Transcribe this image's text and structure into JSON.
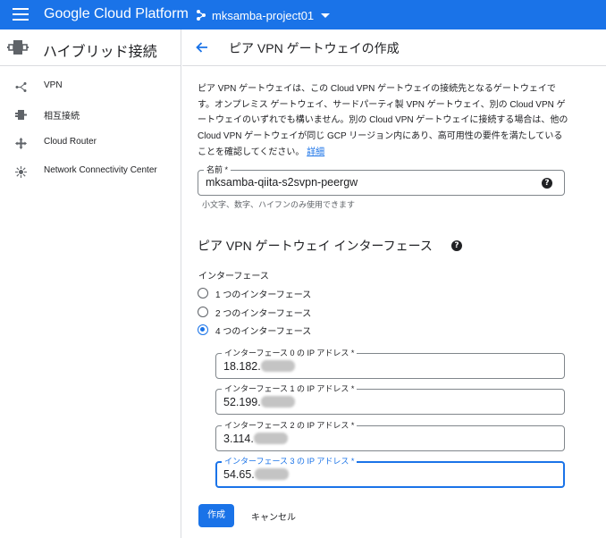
{
  "topbar": {
    "brand": "Google Cloud Platform",
    "project": "mksamba-project01"
  },
  "sidebar": {
    "title": "ハイブリッド接続",
    "items": [
      {
        "label": "VPN",
        "icon": "vpn-icon"
      },
      {
        "label": "相互接続",
        "icon": "interconnect-icon"
      },
      {
        "label": "Cloud Router",
        "icon": "cloud-router-icon"
      },
      {
        "label": "Network Connectivity Center",
        "icon": "network-connectivity-icon"
      }
    ]
  },
  "main": {
    "title": "ピア VPN ゲートウェイの作成",
    "description": "ピア VPN ゲートウェイは、この Cloud VPN ゲートウェイの接続先となるゲートウェイです。オンプレミス ゲートウェイ、サードパーティ製 VPN ゲートウェイ、別の Cloud VPN ゲートウェイのいずれでも構いません。別の Cloud VPN ゲートウェイに接続する場合は、他の Cloud VPN ゲートウェイが同じ GCP リージョン内にあり、高可用性の要件を満たしていることを確認してください。",
    "details_link": "詳細",
    "name_field": {
      "label": "名前 *",
      "value": "mksamba-qiita-s2svpn-peergw",
      "hint": "小文字、数字、ハイフンのみ使用できます"
    },
    "interfaces_section": {
      "title": "ピア VPN ゲートウェイ インターフェース",
      "label": "インターフェース",
      "options": [
        "1 つのインターフェース",
        "2 つのインターフェース",
        "4 つのインターフェース"
      ],
      "selected_index": 2,
      "ip_fields": [
        {
          "label": "インターフェース 0 の IP アドレス *",
          "value": "18.182."
        },
        {
          "label": "インターフェース 1 の IP アドレス *",
          "value": "52.199."
        },
        {
          "label": "インターフェース 2 の IP アドレス *",
          "value": "3.114."
        },
        {
          "label": "インターフェース 3 の IP アドレス *",
          "value": "54.65."
        }
      ]
    },
    "create_label": "作成",
    "cancel_label": "キャンセル"
  },
  "colors": {
    "accent": "#1a73e8",
    "border": "#dadce0"
  }
}
